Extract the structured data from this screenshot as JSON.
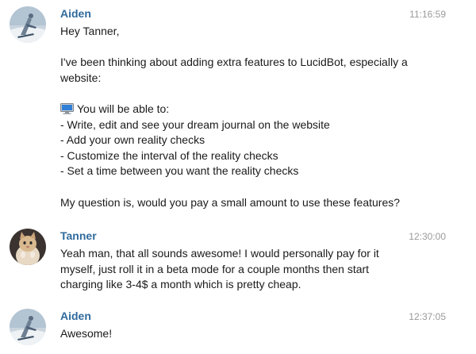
{
  "messages": [
    {
      "sender": "Aiden",
      "time": "11:16:59",
      "greeting": "Hey Tanner,",
      "intro_1": "I've been thinking about adding extra features to LucidBot, especially a",
      "intro_2": "website:",
      "feature_heading_icon": "computer-icon",
      "feature_heading": "You will be able to:",
      "features": [
        "- Write, edit and see your dream journal on the website",
        "- Add your own reality checks",
        "- Customize the interval of the reality checks",
        "- Set a time between you want the reality checks"
      ],
      "question": "My question is, would you pay a small amount to use these features?"
    },
    {
      "sender": "Tanner",
      "time": "12:30:00",
      "lines": [
        "Yeah man, that all sounds awesome! I would personally pay for it",
        "myself, just roll it in a beta mode for a couple months then start",
        "charging like 3-4$ a month which is pretty cheap."
      ]
    },
    {
      "sender": "Aiden",
      "time": "12:37:05",
      "lines": [
        "Awesome!"
      ]
    }
  ],
  "colors": {
    "sender_name": "#2f6a9c",
    "timestamp": "#9a9a9a",
    "text": "#1a1a1a"
  }
}
